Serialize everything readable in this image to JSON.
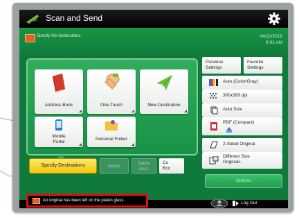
{
  "window": {
    "title": "Scan and Send"
  },
  "info": {
    "instruction": "Specify the destinations.",
    "date": "04/11/2016",
    "time": "9:01 AM"
  },
  "destinations": [
    {
      "label": "Address Book",
      "icon": "address-book-icon"
    },
    {
      "label": "One-Touch",
      "icon": "one-touch-icon"
    },
    {
      "label": "New Destination",
      "icon": "new-destination-icon"
    },
    {
      "label_line1": "Mobile",
      "label_line2": "Portal",
      "icon": "mobile-portal-icon"
    },
    {
      "label": "Personal Folder",
      "icon": "personal-folder-icon"
    }
  ],
  "actions": {
    "specify": "Specify Destinations",
    "details": "Details",
    "delete_line1": "Delete",
    "delete_line2": "Dest.",
    "cc_line1": "Cc",
    "cc_line2": "Bcc"
  },
  "settings": {
    "previous_line1": "Previous",
    "previous_line2": "Settings",
    "favorite_line1": "Favorite",
    "favorite_line2": "Settings",
    "color": "Auto (Color/Gray)",
    "resolution": "300x300 dpi",
    "size": "Auto Size",
    "format_line1": "PDF (Compact)",
    "duplex": "2-Sided Original",
    "mixed_line1": "Different Size",
    "mixed_line2": "Originals",
    "options": "Options"
  },
  "status": {
    "message": "An original has been left on the platen glass.",
    "logout": "Log Out"
  },
  "colors": {
    "screen": "#0f7a3b",
    "accent": "#f3c70a",
    "alert_border": "#e00f12"
  }
}
